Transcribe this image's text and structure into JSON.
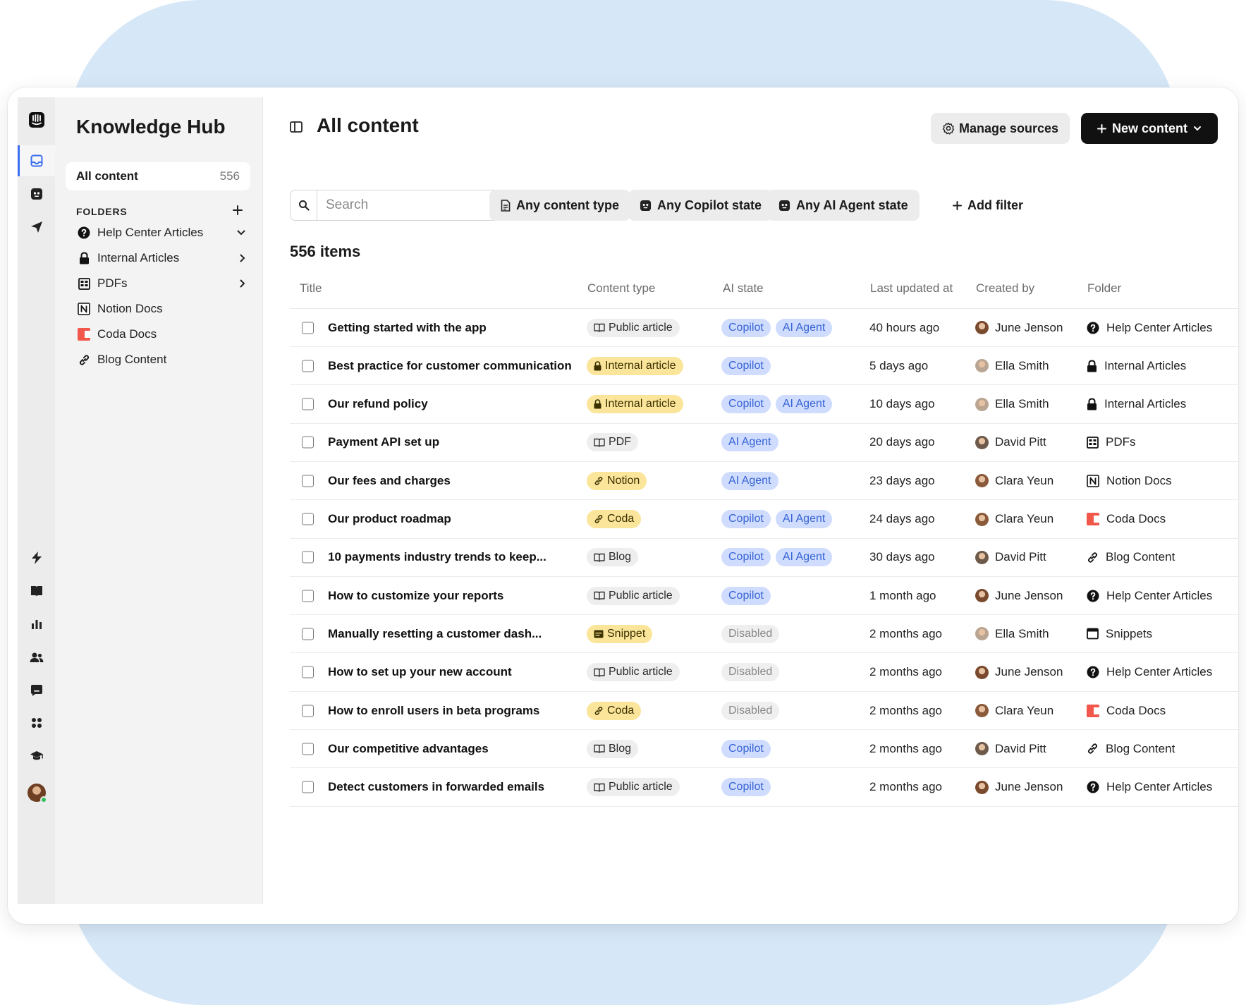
{
  "app": {
    "title": "Knowledge Hub"
  },
  "sidebar": {
    "all_content": {
      "label": "All content",
      "count": "556"
    },
    "folders_heading": "FOLDERS",
    "folders": [
      {
        "label": "Help Center Articles",
        "icon": "help-circle-icon",
        "chevron": "down"
      },
      {
        "label": "Internal Articles",
        "icon": "lock-icon",
        "chevron": "right"
      },
      {
        "label": "PDFs",
        "icon": "pdf-grid-icon",
        "chevron": "right"
      },
      {
        "label": "Notion Docs",
        "icon": "notion-icon",
        "chevron": ""
      },
      {
        "label": "Coda Docs",
        "icon": "coda-icon",
        "chevron": ""
      },
      {
        "label": "Blog Content",
        "icon": "link-icon",
        "chevron": ""
      }
    ]
  },
  "header": {
    "title": "All content",
    "manage_sources": "Manage sources",
    "new_content": "New content"
  },
  "filters": {
    "search_placeholder": "Search",
    "content_type": "Any content type",
    "copilot_state": "Any Copilot state",
    "ai_agent_state": "Any AI Agent state",
    "add_filter": "Add filter"
  },
  "summary": {
    "items_label": "556 items"
  },
  "table": {
    "columns": [
      "Title",
      "Content type",
      "AI state",
      "Last updated at",
      "Created by",
      "Folder"
    ],
    "rows": [
      {
        "title": "Getting started with the app",
        "type": "Public article",
        "type_style": "public",
        "type_icon": "book-icon",
        "ai": [
          "Copilot",
          "AI Agent"
        ],
        "updated": "40 hours ago",
        "creator": "June Jenson",
        "avatar": "#7a4a2e",
        "folder": "Help Center Articles",
        "folder_icon": "help-circle-icon"
      },
      {
        "title": "Best practice for customer communication",
        "type": "Internal article",
        "type_style": "yellow",
        "type_icon": "lock-icon",
        "ai": [
          "Copilot"
        ],
        "updated": "5 days ago",
        "creator": "Ella Smith",
        "avatar": "#b9a592",
        "folder": "Internal Articles",
        "folder_icon": "lock-icon"
      },
      {
        "title": "Our refund policy",
        "type": "Internal article",
        "type_style": "yellow",
        "type_icon": "lock-icon",
        "ai": [
          "Copilot",
          "AI Agent"
        ],
        "updated": "10 days ago",
        "creator": "Ella Smith",
        "avatar": "#b9a592",
        "folder": "Internal Articles",
        "folder_icon": "lock-icon"
      },
      {
        "title": "Payment API set up",
        "type": "PDF",
        "type_style": "public",
        "type_icon": "book-icon",
        "ai": [
          "AI Agent"
        ],
        "updated": "20 days ago",
        "creator": "David Pitt",
        "avatar": "#6d5a4a",
        "folder": "PDFs",
        "folder_icon": "pdf-grid-icon"
      },
      {
        "title": "Our fees and charges",
        "type": "Notion",
        "type_style": "yellow",
        "type_icon": "link-icon",
        "ai": [
          "AI Agent"
        ],
        "updated": "23 days ago",
        "creator": "Clara Yeun",
        "avatar": "#8a5a3a",
        "folder": "Notion Docs",
        "folder_icon": "notion-icon"
      },
      {
        "title": "Our product roadmap",
        "type": "Coda",
        "type_style": "yellow",
        "type_icon": "link-icon",
        "ai": [
          "Copilot",
          "AI Agent"
        ],
        "updated": "24 days ago",
        "creator": "Clara Yeun",
        "avatar": "#8a5a3a",
        "folder": "Coda Docs",
        "folder_icon": "coda-icon"
      },
      {
        "title": "10 payments industry trends to keep...",
        "type": "Blog",
        "type_style": "public",
        "type_icon": "book-icon",
        "ai": [
          "Copilot",
          "AI Agent"
        ],
        "updated": "30 days ago",
        "creator": "David Pitt",
        "avatar": "#6d5a4a",
        "folder": "Blog Content",
        "folder_icon": "link-icon"
      },
      {
        "title": "How to customize your reports",
        "type": "Public article",
        "type_style": "public",
        "type_icon": "book-icon",
        "ai": [
          "Copilot"
        ],
        "updated": "1 month ago",
        "creator": "June Jenson",
        "avatar": "#7a4a2e",
        "folder": "Help Center Articles",
        "folder_icon": "help-circle-icon"
      },
      {
        "title": "Manually resetting a customer dash...",
        "type": "Snippet",
        "type_style": "yellow",
        "type_icon": "snippet-icon",
        "ai": [
          "Disabled"
        ],
        "updated": "2 months ago",
        "creator": "Ella Smith",
        "avatar": "#b9a592",
        "folder": "Snippets",
        "folder_icon": "snippet-icon"
      },
      {
        "title": "How to set up your new account",
        "type": "Public article",
        "type_style": "public",
        "type_icon": "book-icon",
        "ai": [
          "Disabled"
        ],
        "updated": "2 months ago",
        "creator": "June Jenson",
        "avatar": "#7a4a2e",
        "folder": "Help Center Articles",
        "folder_icon": "help-circle-icon"
      },
      {
        "title": "How to enroll users in beta programs",
        "type": "Coda",
        "type_style": "yellow",
        "type_icon": "link-icon",
        "ai": [
          "Disabled"
        ],
        "updated": "2 months ago",
        "creator": "Clara Yeun",
        "avatar": "#8a5a3a",
        "folder": "Coda Docs",
        "folder_icon": "coda-icon"
      },
      {
        "title": "Our competitive advantages",
        "type": "Blog",
        "type_style": "public",
        "type_icon": "book-icon",
        "ai": [
          "Copilot"
        ],
        "updated": "2 months ago",
        "creator": "David Pitt",
        "avatar": "#6d5a4a",
        "folder": "Blog Content",
        "folder_icon": "link-icon"
      },
      {
        "title": "Detect customers in forwarded emails",
        "type": "Public article",
        "type_style": "public",
        "type_icon": "book-icon",
        "ai": [
          "Copilot"
        ],
        "updated": "2 months ago",
        "creator": "June Jenson",
        "avatar": "#7a4a2e",
        "folder": "Help Center Articles",
        "folder_icon": "help-circle-icon"
      }
    ]
  },
  "colors": {
    "accent": "#3a6ff0",
    "backdrop": "#d6e7f7",
    "pill_blue": "#cfdcfd",
    "pill_yellow": "#fbe59a",
    "coda": "#f2574b"
  }
}
